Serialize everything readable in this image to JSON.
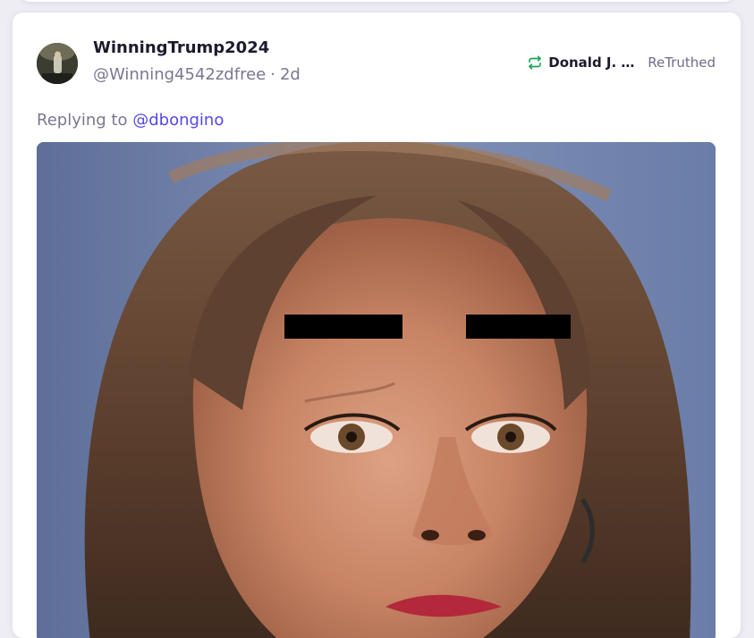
{
  "post": {
    "display_name": "WinningTrump2024",
    "handle": "@Winning4542zdfree",
    "separator": "·",
    "time_ago": "2d",
    "retruth": {
      "name": "Donald J. Trump",
      "label": "ReTruthed",
      "icon": "retruth-icon",
      "icon_color": "#19a45a"
    },
    "reply": {
      "prefix": "Replying to",
      "mention": "@dbongino",
      "mention_color": "#5448ee"
    },
    "media": {
      "type": "photo",
      "subject": "close-up of a woman's face with black censor bars over eyebrows"
    }
  }
}
